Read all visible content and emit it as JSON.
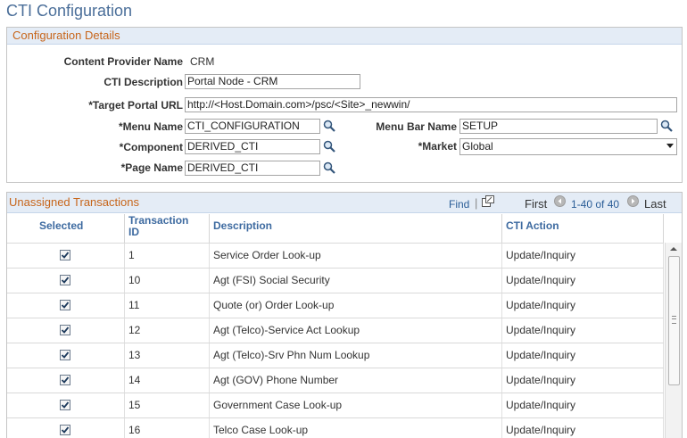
{
  "page": {
    "title": "CTI Configuration"
  },
  "config": {
    "section_title": "Configuration Details",
    "content_provider_label": "Content Provider Name",
    "content_provider_value": "CRM",
    "cti_description_label": "CTI Description",
    "cti_description_value": "Portal Node - CRM",
    "target_url_label": "*Target Portal URL",
    "target_url_value": "http://<Host.Domain.com>/psc/<Site>_newwin/",
    "menu_name_label": "*Menu Name",
    "menu_name_value": "CTI_CONFIGURATION",
    "menu_bar_label": "Menu Bar Name",
    "menu_bar_value": "SETUP",
    "component_label": "*Component",
    "component_value": "DERIVED_CTI",
    "market_label": "*Market",
    "market_value": "Global",
    "page_name_label": "*Page Name",
    "page_name_value": "DERIVED_CTI"
  },
  "grid": {
    "title": "Unassigned Transactions",
    "find_label": "Find",
    "separator": "|",
    "first_label": "First",
    "range_label": "1-40 of 40",
    "last_label": "Last",
    "columns": {
      "selected": "Selected",
      "transaction_id_line1": "Transaction",
      "transaction_id_line2": "ID",
      "description": "Description",
      "cti_action": "CTI Action"
    },
    "rows": [
      {
        "id": "1",
        "description": "Service Order Look-up",
        "action": "Update/Inquiry"
      },
      {
        "id": "10",
        "description": "Agt (FSI) Social Security",
        "action": "Update/Inquiry"
      },
      {
        "id": "11",
        "description": "Quote (or) Order Look-up",
        "action": "Update/Inquiry"
      },
      {
        "id": "12",
        "description": "Agt (Telco)-Service Act Lookup",
        "action": "Update/Inquiry"
      },
      {
        "id": "13",
        "description": "Agt (Telco)-Srv Phn Num Lookup",
        "action": "Update/Inquiry"
      },
      {
        "id": "14",
        "description": "Agt (GOV) Phone Number",
        "action": "Update/Inquiry"
      },
      {
        "id": "15",
        "description": "Government Case Look-up",
        "action": "Update/Inquiry"
      },
      {
        "id": "16",
        "description": "Telco Case Look-up",
        "action": "Update/Inquiry"
      }
    ]
  }
}
